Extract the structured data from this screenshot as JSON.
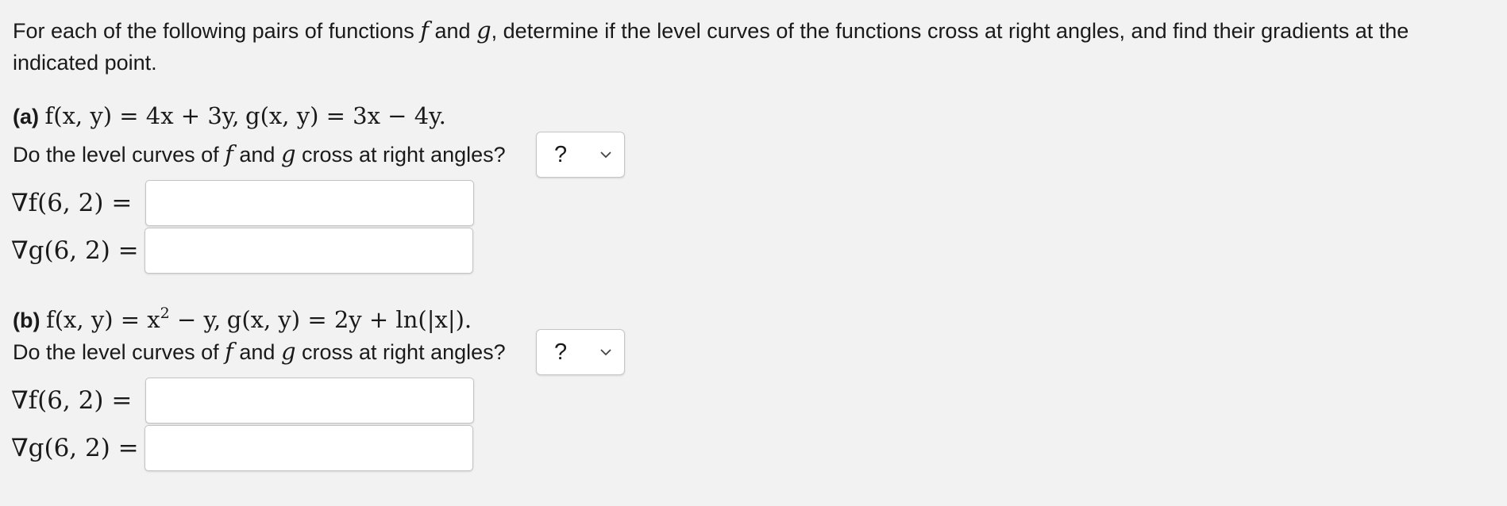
{
  "instructions": "For each of the following pairs of functions f and g, determine if the level curves of the functions cross at right angles, and find their gradients at the indicated point.",
  "instructions_parts": {
    "before_f": "For each of the following pairs of functions ",
    "f": "f",
    "and": " and ",
    "g": "g",
    "after_g": ", determine if the level curves of the functions cross at right angles, and find their gradients at the indicated point."
  },
  "parts": [
    {
      "label": "(a)",
      "f_def": "f(x, y) = 4x + 3y,",
      "g_def": "g(x, y) = 3x − 4y.",
      "question_pre": "Do the level curves of ",
      "question_f": "f",
      "question_mid": " and ",
      "question_g": "g",
      "question_post": " cross at right angles?",
      "select_value": "?",
      "grad_f_label": "∇f(6, 2) =",
      "grad_g_label": "∇g(6, 2) =",
      "grad_f_value": "",
      "grad_g_value": ""
    },
    {
      "label": "(b)",
      "f_def_pre": "f(x, y) = x",
      "f_def_sup": "2",
      "f_def_post": " − y,",
      "g_def": "g(x, y) = 2y + ln(|x|).",
      "question_pre": "Do the level curves of ",
      "question_f": "f",
      "question_mid": " and ",
      "question_g": "g",
      "question_post": " cross at right angles?",
      "select_value": "?",
      "grad_f_label": "∇f(6, 2) =",
      "grad_g_label": "∇g(6, 2) =",
      "grad_f_value": "",
      "grad_g_value": ""
    }
  ],
  "icons": {
    "dropdown": "chevron-down-icon"
  }
}
